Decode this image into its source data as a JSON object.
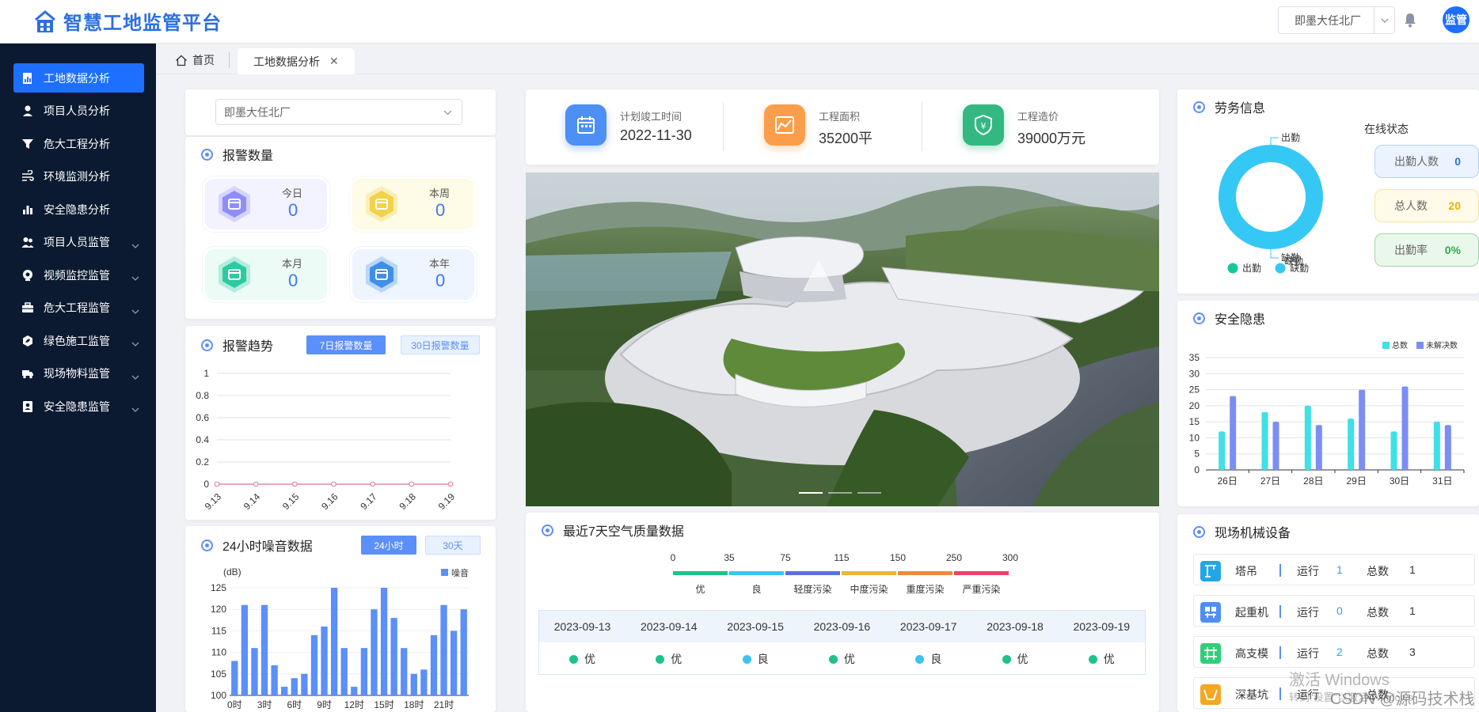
{
  "app": {
    "title": "智慧工地监管平台",
    "project_select": "即墨大任北厂",
    "avatar_label": "监管"
  },
  "sidebar": {
    "items": [
      {
        "label": "工地数据分析",
        "icon": "chart-doc-icon",
        "active": true,
        "expandable": false
      },
      {
        "label": "项目人员分析",
        "icon": "person-icon",
        "active": false,
        "expandable": false
      },
      {
        "label": "危大工程分析",
        "icon": "funnel-icon",
        "active": false,
        "expandable": false
      },
      {
        "label": "环境监测分析",
        "icon": "wind-icon",
        "active": false,
        "expandable": false
      },
      {
        "label": "安全隐患分析",
        "icon": "bar-chart-icon",
        "active": false,
        "expandable": false
      },
      {
        "label": "项目人员监管",
        "icon": "people-icon",
        "active": false,
        "expandable": true
      },
      {
        "label": "视频监控监管",
        "icon": "camera-icon",
        "active": false,
        "expandable": true
      },
      {
        "label": "危大工程监管",
        "icon": "toolbox-icon",
        "active": false,
        "expandable": true
      },
      {
        "label": "绿色施工监管",
        "icon": "leaf-icon",
        "active": false,
        "expandable": true
      },
      {
        "label": "现场物料监管",
        "icon": "truck-icon",
        "active": false,
        "expandable": true
      },
      {
        "label": "安全隐患监管",
        "icon": "shield-user-icon",
        "active": false,
        "expandable": true
      }
    ]
  },
  "tabs": {
    "home": "首页",
    "active": "工地数据分析"
  },
  "left": {
    "project_select": "即墨大任北厂",
    "alarm_title": "报警数量",
    "alarms": [
      {
        "label": "今日",
        "value": "0",
        "color": "#8f8ef7"
      },
      {
        "label": "本周",
        "value": "0",
        "color": "#f2d24a"
      },
      {
        "label": "本月",
        "value": "0",
        "color": "#2ec9a0"
      },
      {
        "label": "本年",
        "value": "0",
        "color": "#3f8fe8"
      }
    ],
    "trend_title": "报警趋势",
    "trend_btn_7": "7日报警数量",
    "trend_btn_30": "30日报警数量",
    "noise_title": "24小时噪音数据",
    "noise_btn_24": "24小时",
    "noise_btn_30": "30天"
  },
  "kpis": [
    {
      "label": "计划竣工时间",
      "value": "2022-11-30",
      "icon": "calendar-icon",
      "color": "#4d8ff5"
    },
    {
      "label": "工程面积",
      "value": "35200平",
      "icon": "area-chart-icon",
      "color": "#fb9e4b"
    },
    {
      "label": "工程造价",
      "value": "39000万元",
      "icon": "yen-shield-icon",
      "color": "#34b882"
    }
  ],
  "air": {
    "title": "最近7天空气质量数据",
    "scale_values": [
      "0",
      "35",
      "75",
      "115",
      "150",
      "250",
      "300"
    ],
    "levels": [
      {
        "label": "优",
        "color": "#1ec28b"
      },
      {
        "label": "良",
        "color": "#3cc3ef"
      },
      {
        "label": "轻度污染",
        "color": "#5b6fe0"
      },
      {
        "label": "中度污染",
        "color": "#e8b53d"
      },
      {
        "label": "重度污染",
        "color": "#ef8a3d"
      },
      {
        "label": "严重污染",
        "color": "#e8436b"
      }
    ],
    "days": [
      {
        "date": "2023-09-13",
        "level": "优",
        "color": "#1ec28b"
      },
      {
        "date": "2023-09-14",
        "level": "优",
        "color": "#1ec28b"
      },
      {
        "date": "2023-09-15",
        "level": "良",
        "color": "#3cc3ef"
      },
      {
        "date": "2023-09-16",
        "level": "优",
        "color": "#1ec28b"
      },
      {
        "date": "2023-09-17",
        "level": "良",
        "color": "#3cc3ef"
      },
      {
        "date": "2023-09-18",
        "level": "优",
        "color": "#1ec28b"
      },
      {
        "date": "2023-09-19",
        "level": "优",
        "color": "#1ec28b"
      }
    ]
  },
  "labor": {
    "title": "劳务信息",
    "status_title": "在线状态",
    "pills": [
      {
        "label": "出勤人数",
        "value": "0",
        "bg": "#eaf3ff",
        "border": "#b7d3f7",
        "color": "#2a6fd6"
      },
      {
        "label": "总人数",
        "value": "20",
        "bg": "#fffbe8",
        "border": "#f4e3a4",
        "color": "#e8b100"
      },
      {
        "label": "出勤率",
        "value": "0%",
        "bg": "#eaf8ec",
        "border": "#9fd6a6",
        "color": "#2ea84a"
      }
    ],
    "donut_label_top": "出勤",
    "donut_label_bottom_a": "缺勤",
    "donut_label_bottom_b": "缺勤",
    "legend": [
      {
        "label": "出勤",
        "color": "#16c79a"
      },
      {
        "label": "缺勤",
        "color": "#36c8f5"
      }
    ]
  },
  "hazard": {
    "title": "安全隐患"
  },
  "machines": {
    "title": "现场机械设备",
    "running_label": "运行",
    "total_label": "总数",
    "rows": [
      {
        "name": "塔吊",
        "running": "1",
        "total": "1",
        "icon": "tower-crane-icon",
        "color": "#23a6e8"
      },
      {
        "name": "起重机",
        "running": "0",
        "total": "1",
        "icon": "crane-icon",
        "color": "#4d8ff5"
      },
      {
        "name": "高支模",
        "running": "2",
        "total": "3",
        "icon": "grid-frame-icon",
        "color": "#2fcf7a"
      },
      {
        "name": "深基坑",
        "running": "",
        "total": "",
        "icon": "pit-icon",
        "color": "#f5a623"
      }
    ]
  },
  "overlay": {
    "win_line1": "激活 Windows",
    "win_line2": "转到\"设置\"以激活 Windows",
    "csdn": "CSDN @源码技术栈"
  },
  "chart_data": [
    {
      "type": "line",
      "name": "alarm-trend",
      "x": [
        "9.13",
        "9.14",
        "9.15",
        "9.16",
        "9.17",
        "9.18",
        "9.19"
      ],
      "series": [
        {
          "values": [
            0,
            0,
            0,
            0,
            0,
            0,
            0
          ],
          "color": "#e38aa0"
        }
      ],
      "yticks": [
        "0",
        "0.2",
        "0.4",
        "0.6",
        "0.8",
        "1"
      ],
      "ylim": [
        0,
        1
      ],
      "grid": true
    },
    {
      "type": "bar",
      "name": "noise-24h",
      "ylabel": "(dB)",
      "legend": [
        "噪音"
      ],
      "categories": [
        "0时",
        "1时",
        "2时",
        "3时",
        "4时",
        "5时",
        "6时",
        "7时",
        "8时",
        "9时",
        "10时",
        "11时",
        "12时",
        "13时",
        "14时",
        "15时",
        "16时",
        "17时",
        "18时",
        "19时",
        "20时",
        "21时",
        "22时",
        "23时"
      ],
      "xtick_labels": [
        "0时",
        "3时",
        "6时",
        "9时",
        "12时",
        "15时",
        "18时",
        "21时"
      ],
      "series": [
        {
          "name": "噪音",
          "values": [
            108,
            121,
            111,
            121,
            107,
            102,
            104,
            105,
            114,
            116,
            125,
            111,
            102,
            111,
            120,
            125,
            118,
            111,
            105,
            106,
            114,
            121,
            115,
            120
          ],
          "color": "#5b8ff9"
        }
      ],
      "yticks": [
        "100",
        "105",
        "110",
        "115",
        "120",
        "125"
      ],
      "ylim": [
        100,
        125
      ]
    },
    {
      "type": "bar",
      "name": "hazard",
      "categories": [
        "26日",
        "27日",
        "28日",
        "29日",
        "30日",
        "31日"
      ],
      "series": [
        {
          "name": "总数",
          "values": [
            12,
            18,
            20,
            16,
            12,
            15
          ],
          "color": "#3fe0e6"
        },
        {
          "name": "未解决数",
          "values": [
            23,
            15,
            14,
            25,
            26,
            14
          ],
          "color": "#7b8ef5"
        }
      ],
      "yticks": [
        "0",
        "5",
        "10",
        "15",
        "20",
        "25",
        "30",
        "35"
      ],
      "ylim": [
        0,
        35
      ],
      "legend_position": "top-right"
    },
    {
      "type": "pie",
      "name": "attendance",
      "labels": [
        "出勤",
        "缺勤"
      ],
      "values": [
        0,
        20
      ],
      "colors": [
        "#16c79a",
        "#36c8f5"
      ]
    }
  ]
}
